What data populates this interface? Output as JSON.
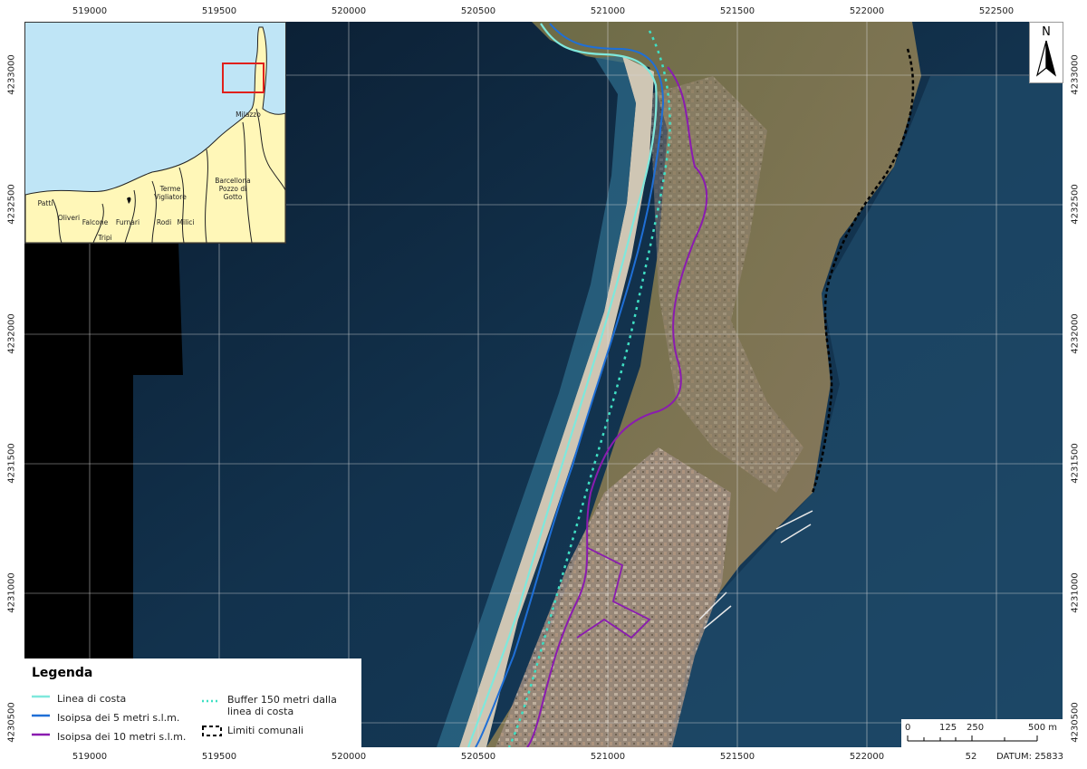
{
  "map": {
    "x_coords": [
      "519000",
      "519500",
      "520000",
      "520500",
      "521000",
      "521500",
      "522000",
      "522500"
    ],
    "y_coords": [
      "4233000",
      "4232500",
      "4232000",
      "4231500",
      "4231000",
      "4230500"
    ]
  },
  "inset": {
    "places": [
      {
        "name": "Milazzo"
      },
      {
        "name": "Terme\nVigliatore"
      },
      {
        "name": "Barcellona\nPozzo di\nGotto"
      },
      {
        "name": "Patti"
      },
      {
        "name": "Oliveri"
      },
      {
        "name": "Falcone"
      },
      {
        "name": "Furnari"
      },
      {
        "name": "Rodi"
      },
      {
        "name": "Milici"
      },
      {
        "name": "Tripi"
      }
    ]
  },
  "north_arrow": {
    "label": "N"
  },
  "legend": {
    "title": "Legenda",
    "items": [
      {
        "label": "Linea di costa",
        "color": "#7fe8dc",
        "style": "solid"
      },
      {
        "label": "Isoipsa dei 5 metri s.l.m.",
        "color": "#1f6fd6",
        "style": "solid"
      },
      {
        "label": "Isoipsa dei 10 metri s.l.m.",
        "color": "#8a1bb0",
        "style": "solid"
      },
      {
        "label": "Buffer 150 metri dalla\nlinea di costa",
        "color": "#3fe0c4",
        "style": "dotted"
      },
      {
        "label": "Limiti comunali",
        "color": "#000000",
        "style": "dashed"
      }
    ]
  },
  "scalebar": {
    "labels": [
      "0",
      "125",
      "250",
      "500 m"
    ]
  },
  "datum": "DATUM: 25833",
  "stray_label": "52"
}
